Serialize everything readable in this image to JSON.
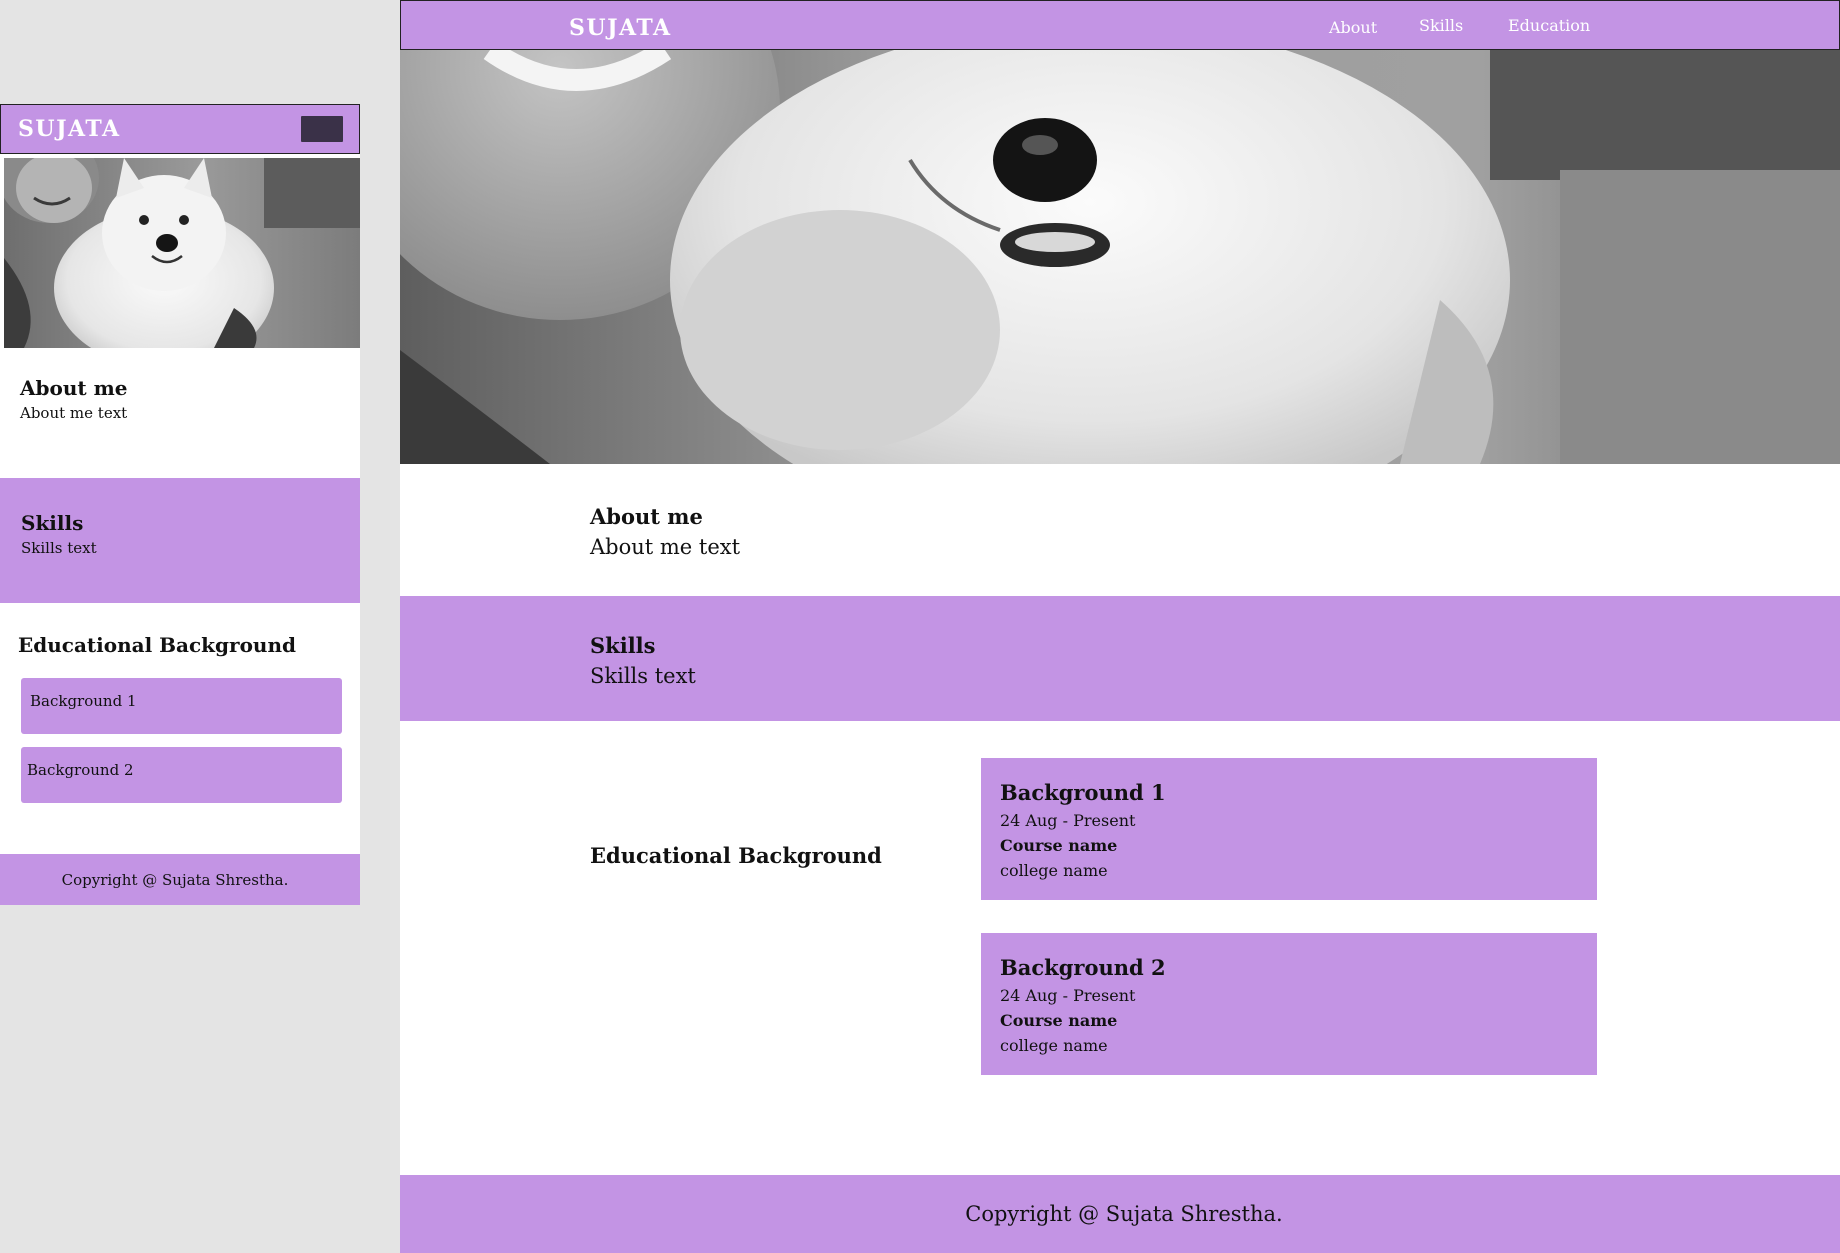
{
  "colors": {
    "accent": "#c394e4",
    "canvas": "#e4e4e4",
    "menu_button": "#3a3148"
  },
  "mobile": {
    "brand": "SUJATA",
    "menu_icon": "menu-button",
    "about": {
      "title": "About me",
      "text": "About me text"
    },
    "skills": {
      "title": "Skills",
      "text": "Skills text"
    },
    "education": {
      "title": "Educational Background",
      "items": [
        {
          "label": "Background 1"
        },
        {
          "label": "Background 2"
        }
      ]
    },
    "footer": "Copyright @ Sujata Shrestha."
  },
  "desktop": {
    "brand": "SUJATA",
    "nav": [
      {
        "label": "About"
      },
      {
        "label": "Skills"
      },
      {
        "label": "Education"
      }
    ],
    "about": {
      "title": "About me",
      "text": "About me text"
    },
    "skills": {
      "title": "Skills",
      "text": "Skills text"
    },
    "education": {
      "title": "Educational Background",
      "items": [
        {
          "title": "Background 1",
          "dates": "24 Aug - Present",
          "course": "Course name",
          "college": "college name"
        },
        {
          "title": "Background 2",
          "dates": "24 Aug - Present",
          "course": "Course name",
          "college": "college name"
        }
      ]
    },
    "footer": "Copyright @ Sujata Shrestha."
  }
}
